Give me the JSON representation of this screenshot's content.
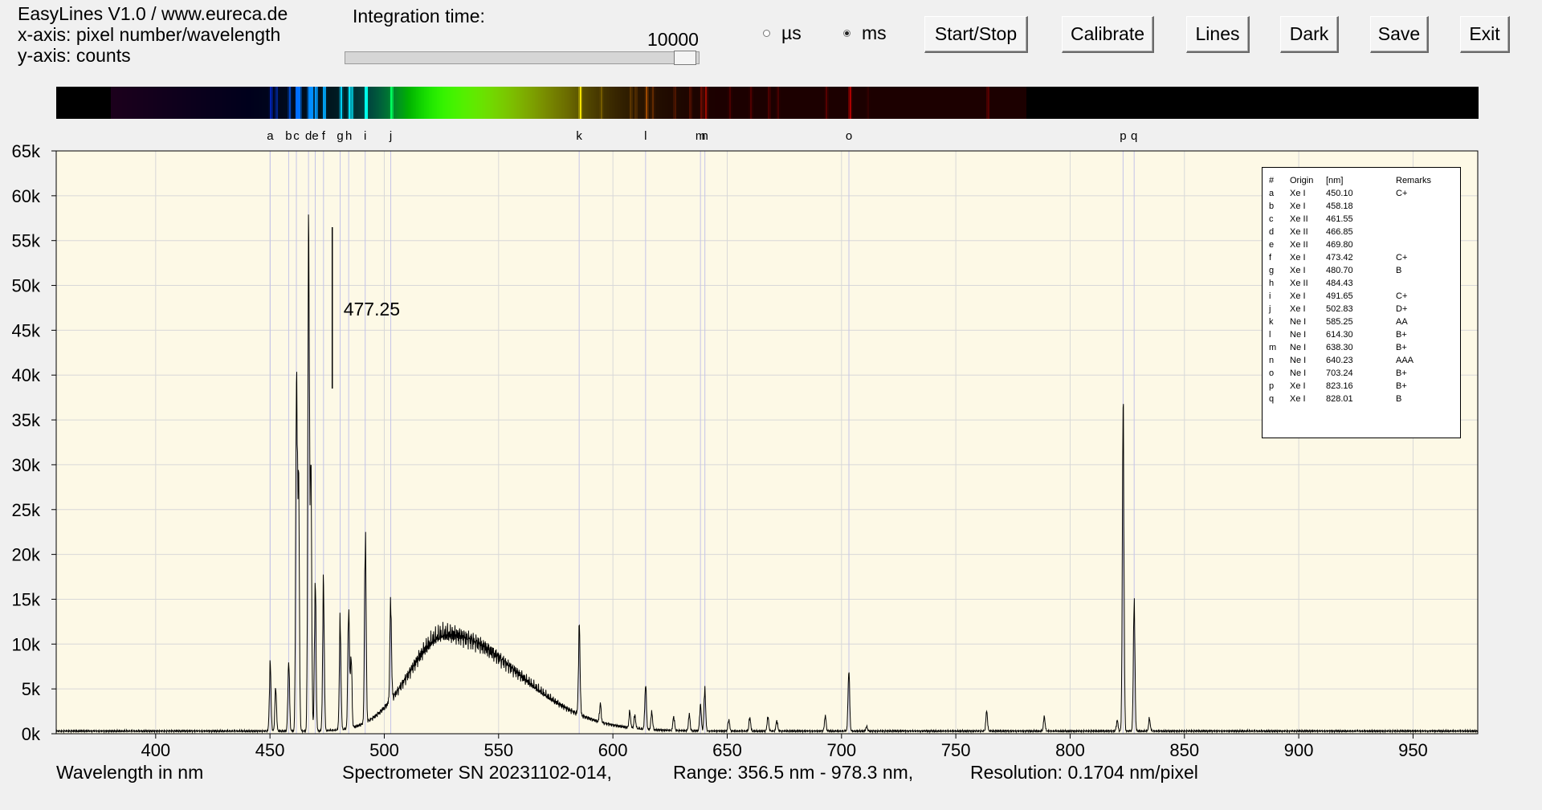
{
  "app": {
    "title_line": "EasyLines V1.0 / www.eureca.de",
    "x_axis_line": "x-axis: pixel number/wavelength",
    "y_axis_line": "y-axis: counts"
  },
  "integration": {
    "label": "Integration time:",
    "value": "10000",
    "slider_fraction": 0.99
  },
  "units": {
    "us_label": "µs",
    "ms_label": "ms",
    "selected": "ms"
  },
  "buttons": {
    "start_stop": "Start/Stop",
    "calibrate": "Calibrate",
    "lines": "Lines",
    "dark": "Dark",
    "save": "Save",
    "exit": "Exit"
  },
  "footer": {
    "axis_title": "Wavelength in nm",
    "spectrometer": "Spectrometer SN 20231102-014,",
    "range": "Range: 356.5 nm - 978.3 nm,",
    "resolution": "Resolution: 0.1704 nm/pixel"
  },
  "annotation": {
    "label": "477.25",
    "wavelength": 477.25
  },
  "colors": {
    "plot_bg": "#fdf9e6",
    "line_marker": "#c4c4e8",
    "trace": "#000000",
    "window_bg": "#f0f0f0"
  },
  "legend": {
    "headers": [
      "#",
      "Origin",
      "[nm]",
      "Remarks"
    ],
    "rows": [
      [
        "a",
        "Xe I",
        "450.10",
        "C+"
      ],
      [
        "b",
        "Xe I",
        "458.18",
        ""
      ],
      [
        "c",
        "Xe II",
        "461.55",
        ""
      ],
      [
        "d",
        "Xe II",
        "466.85",
        ""
      ],
      [
        "e",
        "Xe II",
        "469.80",
        ""
      ],
      [
        "f",
        "Xe I",
        "473.42",
        "C+"
      ],
      [
        "g",
        "Xe I",
        "480.70",
        "B"
      ],
      [
        "h",
        "Xe II",
        "484.43",
        ""
      ],
      [
        "i",
        "Xe I",
        "491.65",
        "C+"
      ],
      [
        "j",
        "Xe I",
        "502.83",
        "D+"
      ],
      [
        "k",
        "Ne I",
        "585.25",
        "AA"
      ],
      [
        "l",
        "Ne I",
        "614.30",
        "B+"
      ],
      [
        "m",
        "Ne I",
        "638.30",
        "B+"
      ],
      [
        "n",
        "Ne I",
        "640.23",
        "AAA"
      ],
      [
        "o",
        "Ne I",
        "703.24",
        "B+"
      ],
      [
        "p",
        "Xe I",
        "823.16",
        "B+"
      ],
      [
        "q",
        "Xe I",
        "828.01",
        "B"
      ]
    ]
  },
  "chart_data": {
    "type": "line",
    "xlabel": "Wavelength in nm",
    "ylabel": "",
    "xlim": [
      356.5,
      978.3
    ],
    "ylim": [
      0,
      65000
    ],
    "x_ticks": [
      400,
      450,
      500,
      550,
      600,
      650,
      700,
      750,
      800,
      850,
      900,
      950
    ],
    "y_ticks": [
      0,
      5000,
      10000,
      15000,
      20000,
      25000,
      30000,
      35000,
      40000,
      45000,
      50000,
      55000,
      60000,
      65000
    ],
    "y_tick_labels": [
      "0k",
      "5k",
      "10k",
      "15k",
      "20k",
      "25k",
      "30k",
      "35k",
      "40k",
      "45k",
      "50k",
      "55k",
      "60k",
      "65k"
    ],
    "grid": true,
    "baseline": 300,
    "continuum": {
      "center": 527,
      "peak": 10800,
      "sigma_left": 16,
      "sigma_right": 31
    },
    "peaks": [
      [
        450.1,
        7500
      ],
      [
        452.5,
        4800
      ],
      [
        458.2,
        7800
      ],
      [
        461.6,
        38500
      ],
      [
        462.5,
        28000
      ],
      [
        466.9,
        55800
      ],
      [
        467.9,
        29000
      ],
      [
        469.8,
        16700
      ],
      [
        473.4,
        16500
      ],
      [
        480.7,
        12000
      ],
      [
        484.4,
        13300
      ],
      [
        485.5,
        8000
      ],
      [
        491.7,
        20700
      ],
      [
        502.8,
        11000
      ],
      [
        585.3,
        9800
      ],
      [
        594.5,
        2000
      ],
      [
        607.4,
        1800
      ],
      [
        609.6,
        1500
      ],
      [
        614.3,
        5000
      ],
      [
        617.0,
        2000
      ],
      [
        626.6,
        1600
      ],
      [
        633.4,
        1800
      ],
      [
        638.3,
        3000
      ],
      [
        640.2,
        4800
      ],
      [
        650.7,
        1300
      ],
      [
        659.9,
        1500
      ],
      [
        667.8,
        1600
      ],
      [
        671.7,
        1200
      ],
      [
        692.9,
        1700
      ],
      [
        703.2,
        6800
      ],
      [
        711.0,
        500
      ],
      [
        763.5,
        2200
      ],
      [
        788.7,
        1600
      ],
      [
        820.6,
        1200
      ],
      [
        823.2,
        36300
      ],
      [
        828.0,
        14200
      ],
      [
        834.7,
        1400
      ]
    ],
    "spectral_lines": [
      {
        "id": "a",
        "nm": 450.1
      },
      {
        "id": "b",
        "nm": 458.18
      },
      {
        "id": "c",
        "nm": 461.55
      },
      {
        "id": "d",
        "nm": 466.85
      },
      {
        "id": "e",
        "nm": 469.8
      },
      {
        "id": "f",
        "nm": 473.42
      },
      {
        "id": "g",
        "nm": 480.7
      },
      {
        "id": "h",
        "nm": 484.43
      },
      {
        "id": "i",
        "nm": 491.65
      },
      {
        "id": "j",
        "nm": 502.83
      },
      {
        "id": "k",
        "nm": 585.25
      },
      {
        "id": "l",
        "nm": 614.3
      },
      {
        "id": "m",
        "nm": 638.3
      },
      {
        "id": "n",
        "nm": 640.23
      },
      {
        "id": "o",
        "nm": 703.24
      },
      {
        "id": "p",
        "nm": 823.16
      },
      {
        "id": "q",
        "nm": 828.01
      }
    ]
  }
}
